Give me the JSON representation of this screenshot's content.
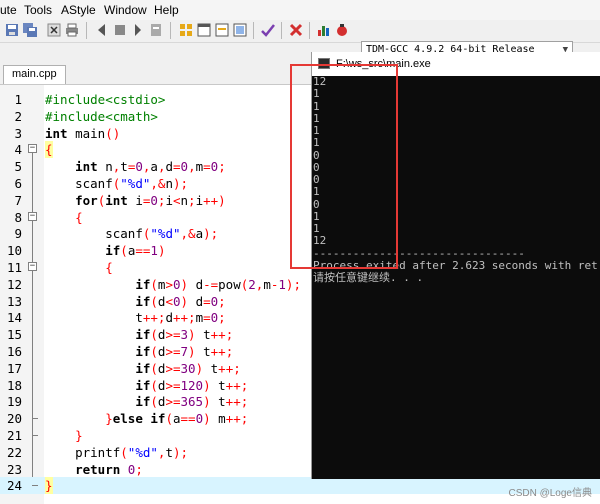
{
  "menubar": {
    "items": [
      "ute",
      "Tools",
      "AStyle",
      "Window",
      "Help"
    ]
  },
  "toolbar": {
    "compiler_select": "TDM-GCC 4.9.2 64-bit Release",
    "icons": [
      "save-icon",
      "save-all-icon",
      "close-icon",
      "print-icon",
      "back-icon",
      "forward-icon",
      "toggle-bookmark-icon",
      "goto-bookmark-icon",
      "grid-icon",
      "window-icon",
      "window-alt-icon",
      "tile-icon",
      "check-icon",
      "delete-icon",
      "chart-icon",
      "debug-icon"
    ]
  },
  "editor": {
    "tab_label": "main.cpp",
    "lines": [
      {
        "n": "1",
        "code": "#include<cstdio>"
      },
      {
        "n": "2",
        "code": "#include<cmath>"
      },
      {
        "n": "3",
        "code": "int main()"
      },
      {
        "n": "4",
        "code": "{"
      },
      {
        "n": "5",
        "code": "    int n,t=0,a,d=0,m=0;"
      },
      {
        "n": "6",
        "code": "    scanf(\"%d\",&n);"
      },
      {
        "n": "7",
        "code": "    for(int i=0;i<n;i++)"
      },
      {
        "n": "8",
        "code": "    {"
      },
      {
        "n": "9",
        "code": "        scanf(\"%d\",&a);"
      },
      {
        "n": "10",
        "code": "        if(a==1)"
      },
      {
        "n": "11",
        "code": "        {"
      },
      {
        "n": "12",
        "code": "            if(m>0) d-=pow(2,m-1);"
      },
      {
        "n": "13",
        "code": "            if(d<0) d=0;"
      },
      {
        "n": "14",
        "code": "            t++;d++;m=0;"
      },
      {
        "n": "15",
        "code": "            if(d>=3) t++;"
      },
      {
        "n": "16",
        "code": "            if(d>=7) t++;"
      },
      {
        "n": "17",
        "code": "            if(d>=30) t++;"
      },
      {
        "n": "18",
        "code": "            if(d>=120) t++;"
      },
      {
        "n": "19",
        "code": "            if(d>=365) t++;"
      },
      {
        "n": "20",
        "code": "        }else if(a==0) m++;"
      },
      {
        "n": "21",
        "code": "    }"
      },
      {
        "n": "22",
        "code": "    printf(\"%d\",t);"
      },
      {
        "n": "23",
        "code": "    return 0;"
      },
      {
        "n": "24",
        "code": "}"
      }
    ]
  },
  "console": {
    "title": "F:\\ws_src\\main.exe",
    "output_lines": [
      "12",
      "1",
      "1",
      "1",
      "1",
      "1",
      "0",
      "0",
      "0",
      "1",
      "0",
      "1",
      "1",
      "12",
      "--------------------------------",
      "Process exited after 2.623 seconds with ret",
      "请按任意键继续. . ."
    ]
  },
  "watermark": "CSDN @Loge信典"
}
